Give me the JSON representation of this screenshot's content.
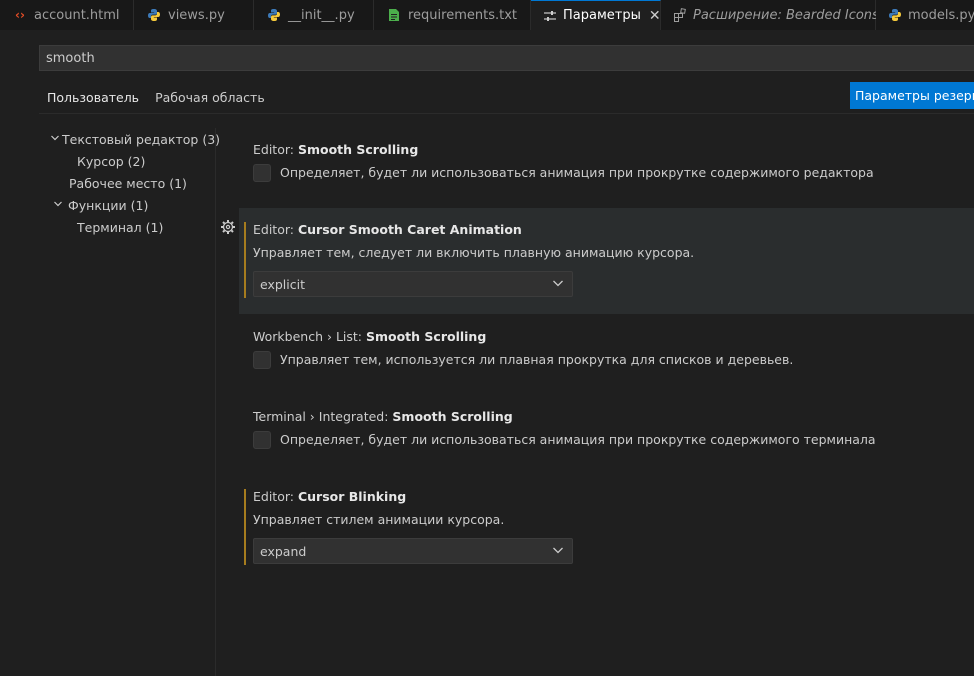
{
  "tabs": [
    {
      "label": "account.html",
      "icon": "html-icon",
      "icon_color": "#e44d26",
      "active": false
    },
    {
      "label": "views.py",
      "icon": "python-icon",
      "active": false
    },
    {
      "label": "__init__.py",
      "icon": "python-icon",
      "active": false
    },
    {
      "label": "requirements.txt",
      "icon": "text-file-icon",
      "icon_color": "#4cae4c",
      "active": false
    },
    {
      "label": "Параметры",
      "icon": "settings-icon",
      "active": true
    },
    {
      "label": "Расширение: Bearded Icons",
      "icon": "extension-icon",
      "active": false
    },
    {
      "label": "models.py",
      "icon": "python-icon",
      "active": false
    }
  ],
  "search": {
    "value": "smooth"
  },
  "scopes": {
    "user": "Пользователь",
    "workspace": "Рабочая область"
  },
  "backup_button": "Параметры резервного копирования",
  "toc": [
    {
      "label": "Текстовый редактор (3)",
      "level": 0,
      "expanded": true
    },
    {
      "label": "Курсор (2)",
      "level": 1
    },
    {
      "label": "Рабочее место (1)",
      "level": 0
    },
    {
      "label": "Функции (1)",
      "level": 0,
      "expanded": true
    },
    {
      "label": "Терминал (1)",
      "level": 1
    }
  ],
  "settings": [
    {
      "category": "Editor: ",
      "name": "Smooth Scrolling",
      "description": "Определяет, будет ли использоваться анимация при прокрутке содержимого редактора",
      "type": "checkbox",
      "checked": false
    },
    {
      "category": "Editor: ",
      "name": "Cursor Smooth Caret Animation",
      "description": "Управляет тем, следует ли включить плавную анимацию курсора.",
      "type": "select",
      "value": "explicit",
      "modified": true
    },
    {
      "category": "Workbench › List: ",
      "name": "Smooth Scrolling",
      "description": "Управляет тем, используется ли плавная прокрутка для списков и деревьев.",
      "type": "checkbox",
      "checked": false
    },
    {
      "category": "Terminal › Integrated: ",
      "name": "Smooth Scrolling",
      "description": "Определяет, будет ли использоваться анимация при прокрутке содержимого терминала",
      "type": "checkbox",
      "checked": false
    },
    {
      "category": "Editor: ",
      "name": "Cursor Blinking",
      "description": "Управляет стилем анимации курсора.",
      "type": "select",
      "value": "expand",
      "modified": true
    }
  ],
  "colors": {
    "accent": "#0078d4",
    "modified": "#a67c1e"
  }
}
